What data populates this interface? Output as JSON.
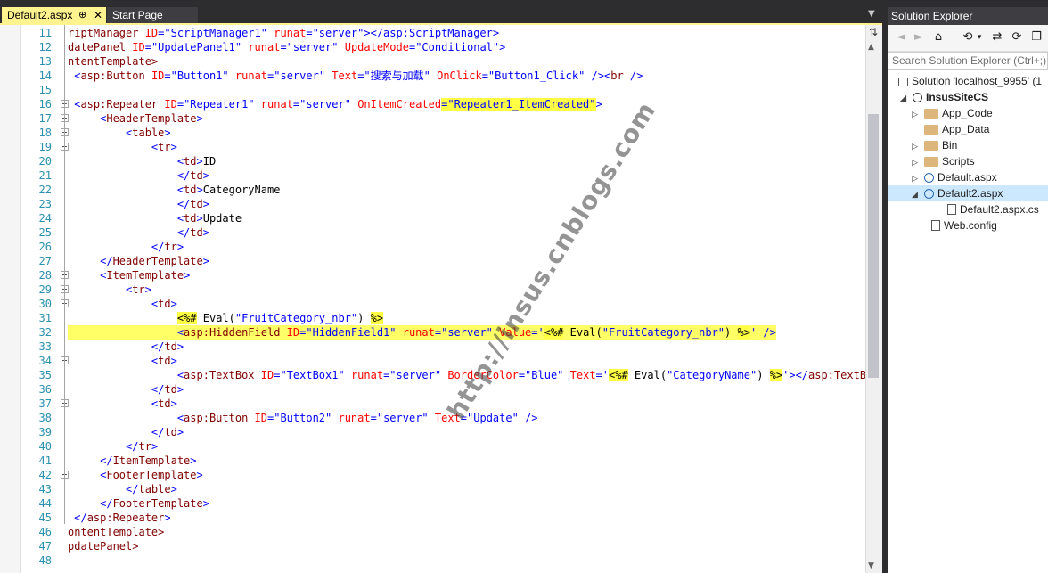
{
  "tabs": {
    "active_label": "Default2.aspx",
    "active_pin": "⊕",
    "active_close": "✕",
    "start_label": "Start Page",
    "dropdown": "▼"
  },
  "editor": {
    "line_numbers": [
      "11",
      "12",
      "13",
      "14",
      "15",
      "16",
      "17",
      "18",
      "19",
      "20",
      "21",
      "22",
      "23",
      "24",
      "25",
      "26",
      "27",
      "28",
      "29",
      "30",
      "31",
      "32",
      "33",
      "34",
      "35",
      "36",
      "37",
      "38",
      "39",
      "40",
      "41",
      "42",
      "43",
      "44",
      "45",
      "46",
      "47",
      "48"
    ]
  },
  "code": {
    "l11": [
      "riptManager ",
      "ID",
      "=",
      "\"ScriptManager1\"",
      " ",
      "runat",
      "=",
      "\"server\"",
      "></asp:ScriptManager>"
    ],
    "l12": [
      "datePanel ",
      "ID",
      "=",
      "\"UpdatePanel1\"",
      " ",
      "runat",
      "=",
      "\"server\"",
      " ",
      "UpdateMode",
      "=",
      "\"Conditional\"",
      ">"
    ],
    "l13": [
      "ntentTemplate>"
    ],
    "l14": [
      " <",
      "asp:Button",
      " ",
      "ID",
      "=",
      "\"Button1\"",
      " ",
      "runat",
      "=",
      "\"server\"",
      " ",
      "Text",
      "=",
      "\"搜索与加载\"",
      " ",
      "OnClick",
      "=",
      "\"Button1_Click\"",
      " />",
      "<",
      "br",
      " />"
    ],
    "l16": [
      " <",
      "asp:Repeater",
      " ",
      "ID",
      "=",
      "\"Repeater1\"",
      " ",
      "runat",
      "=",
      "\"server\"",
      " ",
      "OnItemCreated",
      "=",
      "\"Repeater1_ItemCreated\"",
      ">"
    ],
    "l17": [
      "     <",
      "HeaderTemplate",
      ">"
    ],
    "l18": [
      "         <",
      "table",
      ">"
    ],
    "l19": [
      "             <",
      "tr",
      ">"
    ],
    "l20": [
      "                 <",
      "td",
      ">",
      "ID"
    ],
    "l21": [
      "                 </",
      "td",
      ">"
    ],
    "l22": [
      "                 <",
      "td",
      ">",
      "CategoryName"
    ],
    "l23": [
      "                 </",
      "td",
      ">"
    ],
    "l24": [
      "                 <",
      "td",
      ">",
      "Update"
    ],
    "l25": [
      "                 </",
      "td",
      ">"
    ],
    "l26": [
      "             </",
      "tr",
      ">"
    ],
    "l27": [
      "     </",
      "HeaderTemplate",
      ">"
    ],
    "l28": [
      "     <",
      "ItemTemplate",
      ">"
    ],
    "l29": [
      "         <",
      "tr",
      ">"
    ],
    "l30": [
      "             <",
      "td",
      ">"
    ],
    "l31": [
      "                 ",
      "<%#",
      " Eval(",
      "\"FruitCategory_nbr\"",
      ") ",
      "%>"
    ],
    "l32": [
      "                 <",
      "asp:HiddenField",
      " ",
      "ID",
      "=",
      "\"HiddenField1\"",
      " ",
      "runat",
      "=",
      "\"server\"",
      " ",
      "Value",
      "=",
      "'",
      "<%#",
      " Eval(",
      "\"FruitCategory_nbr\"",
      ") ",
      "%>",
      "'",
      " />"
    ],
    "l33": [
      "             </",
      "td",
      ">"
    ],
    "l34": [
      "             <",
      "td",
      ">"
    ],
    "l35": [
      "                 <",
      "asp:TextBox",
      " ",
      "ID",
      "=",
      "\"TextBox1\"",
      " ",
      "runat",
      "=",
      "\"server\"",
      " ",
      "BorderColor",
      "=",
      "\"Blue\"",
      " ",
      "Text",
      "=",
      "'",
      "<%#",
      " Eval(",
      "\"CategoryName\"",
      ") ",
      "%>",
      "'",
      "></",
      "asp:TextBox",
      ">"
    ],
    "l36": [
      "             </",
      "td",
      ">"
    ],
    "l37": [
      "             <",
      "td",
      ">"
    ],
    "l38": [
      "                 <",
      "asp:Button",
      " ",
      "ID",
      "=",
      "\"Button2\"",
      " ",
      "runat",
      "=",
      "\"server\"",
      " ",
      "Text",
      "=",
      "\"Update\"",
      " />"
    ],
    "l39": [
      "             </",
      "td",
      ">"
    ],
    "l40": [
      "         </",
      "tr",
      ">"
    ],
    "l41": [
      "     </",
      "ItemTemplate",
      ">"
    ],
    "l42": [
      "     <",
      "FooterTemplate",
      ">"
    ],
    "l43": [
      "         </",
      "table",
      ">"
    ],
    "l44": [
      "     </",
      "FooterTemplate",
      ">"
    ],
    "l45": [
      " </",
      "asp:Repeater",
      ">"
    ],
    "l46": [
      "ontentTemplate>"
    ],
    "l47": [
      "pdatePanel>"
    ]
  },
  "scrollbar": {
    "split": "⇅",
    "up": "▲",
    "down": "▼"
  },
  "solution_explorer": {
    "title": "Solution Explorer",
    "search_placeholder": "Search Solution Explorer (Ctrl+;)",
    "toolbar": [
      "◄",
      "►",
      "⌂",
      "⟲",
      "▾",
      "⇄",
      "⟳",
      "❐"
    ],
    "tree": [
      {
        "label": "Solution 'localhost_9955' (1"
      },
      {
        "label": "InsusSiteCS"
      },
      {
        "label": "App_Code"
      },
      {
        "label": "App_Data"
      },
      {
        "label": "Bin"
      },
      {
        "label": "Scripts"
      },
      {
        "label": "Default.aspx"
      },
      {
        "label": "Default2.aspx"
      },
      {
        "label": "Default2.aspx.cs"
      },
      {
        "label": "Web.config"
      }
    ]
  },
  "watermark": "http://insus.cnblogs.com"
}
